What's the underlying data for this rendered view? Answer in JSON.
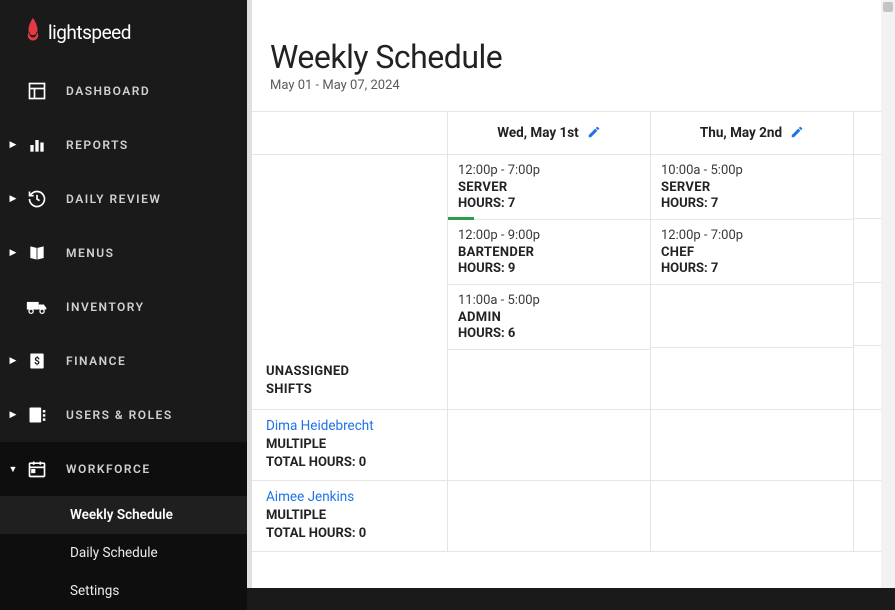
{
  "brand": {
    "name": "lightspeed"
  },
  "nav": {
    "items": [
      {
        "label": "DASHBOARD",
        "icon": "dashboard",
        "caret": false
      },
      {
        "label": "REPORTS",
        "icon": "bar-chart",
        "caret": true
      },
      {
        "label": "DAILY REVIEW",
        "icon": "history",
        "caret": true
      },
      {
        "label": "MENUS",
        "icon": "book",
        "caret": true
      },
      {
        "label": "INVENTORY",
        "icon": "truck",
        "caret": false
      },
      {
        "label": "FINANCE",
        "icon": "money",
        "caret": true
      },
      {
        "label": "USERS & ROLES",
        "icon": "users",
        "caret": true
      },
      {
        "label": "WORKFORCE",
        "icon": "calendar",
        "caret": true,
        "expanded": true
      }
    ],
    "subitems": [
      {
        "label": "Weekly Schedule",
        "active": true
      },
      {
        "label": "Daily Schedule",
        "active": false
      },
      {
        "label": "Settings",
        "active": false
      }
    ]
  },
  "page": {
    "title": "Weekly Schedule",
    "subtitle": "May 01 - May 07, 2024"
  },
  "days": [
    {
      "label": "Wed, May 1st"
    },
    {
      "label": "Thu, May 2nd"
    }
  ],
  "unassigned": {
    "label_line1": "UNASSIGNED",
    "label_line2": "SHIFTS",
    "columns": [
      [
        {
          "time": "12:00p - 7:00p",
          "role": "SERVER",
          "hours": "HOURS: 7",
          "accent": true
        },
        {
          "time": "12:00p - 9:00p",
          "role": "BARTENDER",
          "hours": "HOURS: 9",
          "accent": false
        },
        {
          "time": "11:00a - 5:00p",
          "role": "ADMIN",
          "hours": "HOURS: 6",
          "accent": false
        }
      ],
      [
        {
          "time": "10:00a - 5:00p",
          "role": "SERVER",
          "hours": "HOURS: 7",
          "accent": false
        },
        {
          "time": "12:00p - 7:00p",
          "role": "CHEF",
          "hours": "HOURS: 7",
          "accent": false
        }
      ]
    ]
  },
  "employees": [
    {
      "name": "Dima Heidebrecht",
      "type": "MULTIPLE",
      "total": "TOTAL HOURS: 0"
    },
    {
      "name": "Aimee Jenkins",
      "type": "MULTIPLE",
      "total": "TOTAL HOURS: 0"
    }
  ]
}
